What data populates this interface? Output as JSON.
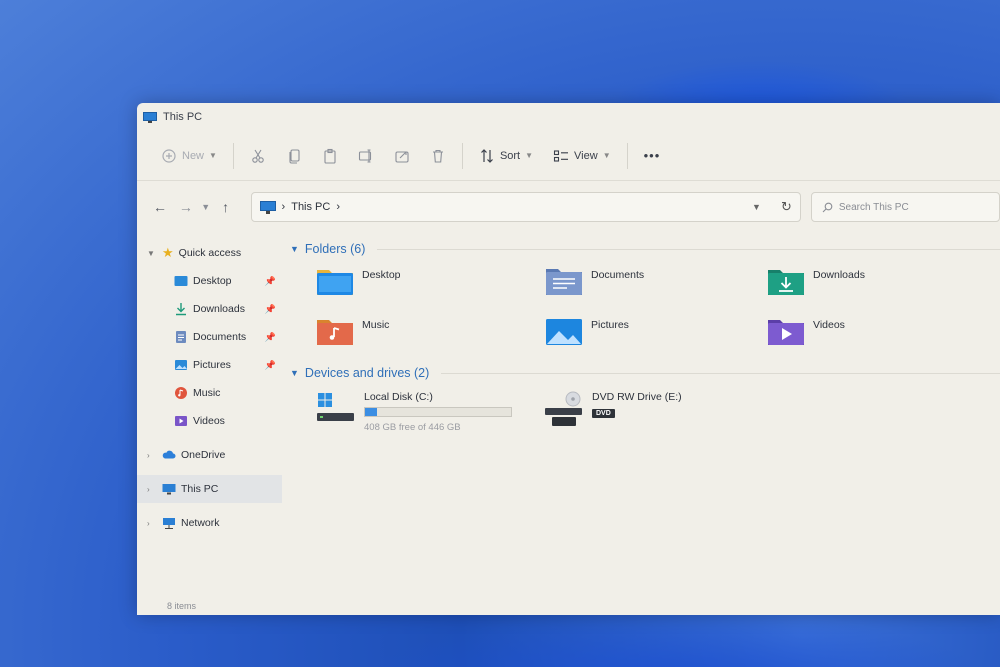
{
  "window": {
    "title": "This PC"
  },
  "toolbar": {
    "new_label": "New",
    "sort_label": "Sort",
    "view_label": "View",
    "more_label": "•••"
  },
  "navbar": {
    "address_path": "This PC",
    "address_chevron": "›",
    "search_placeholder": "Search This PC"
  },
  "sidebar": {
    "quick_access": "Quick access",
    "quick_items": [
      {
        "label": "Desktop"
      },
      {
        "label": "Downloads"
      },
      {
        "label": "Documents"
      },
      {
        "label": "Pictures"
      },
      {
        "label": "Music"
      },
      {
        "label": "Videos"
      }
    ],
    "onedrive": "OneDrive",
    "this_pc": "This PC",
    "network": "Network"
  },
  "content": {
    "folders_header": "Folders (6)",
    "folders": [
      {
        "label": "Desktop"
      },
      {
        "label": "Documents"
      },
      {
        "label": "Downloads"
      },
      {
        "label": "Music"
      },
      {
        "label": "Pictures"
      },
      {
        "label": "Videos"
      }
    ],
    "drives_header": "Devices and drives (2)",
    "drives": [
      {
        "label": "Local Disk (C:)",
        "free_text": "408 GB free of 446 GB",
        "used_fraction": 0.085
      },
      {
        "label": "DVD RW Drive (E:)",
        "badge": "DVD"
      }
    ]
  },
  "status": {
    "items_text": "8 items"
  },
  "colors": {
    "accent": "#2f6fb8",
    "drive_fill": "#3b8ee3",
    "window_bg": "#f1efe8"
  }
}
